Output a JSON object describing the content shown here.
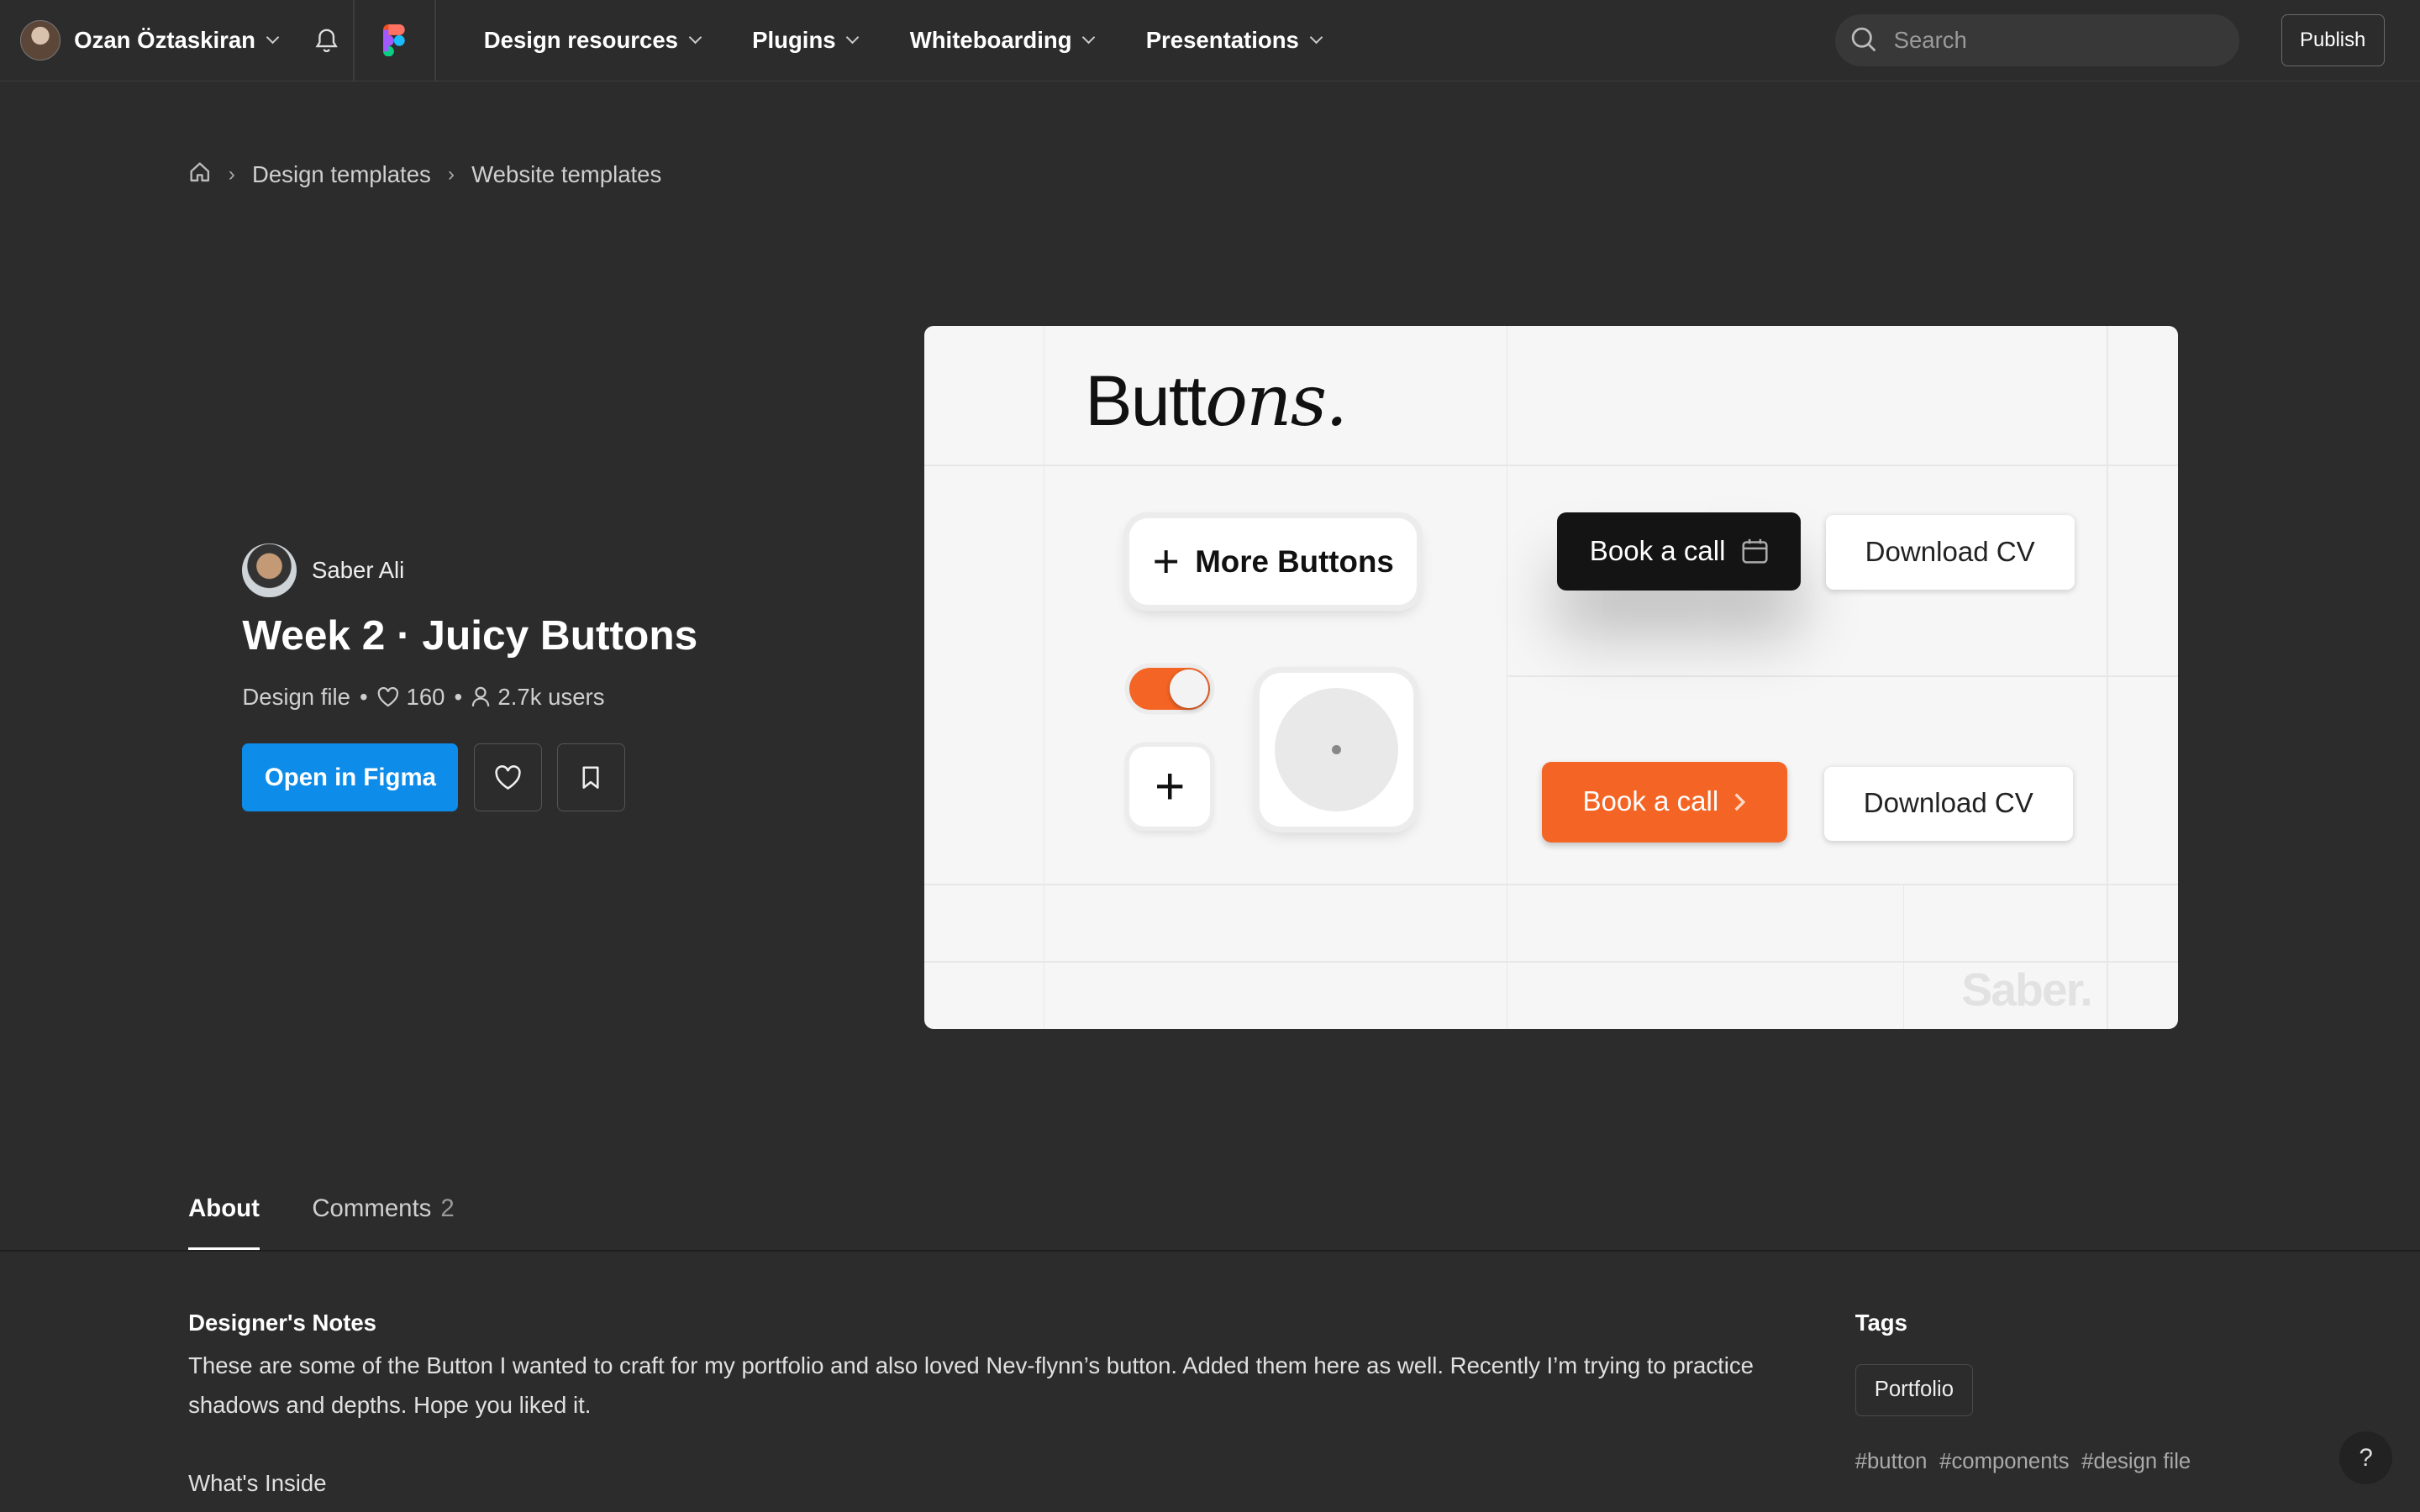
{
  "topbar": {
    "user_name": "Ozan Öztaskiran",
    "nav": [
      "Design resources",
      "Plugins",
      "Whiteboarding",
      "Presentations"
    ],
    "search_placeholder": "Search",
    "publish_label": "Publish"
  },
  "breadcrumb": [
    "Design templates",
    "Website templates"
  ],
  "file": {
    "author": "Saber Ali",
    "title": "Week 2 · Juicy Buttons",
    "type": "Design file",
    "likes": "160",
    "users": "2.7k users",
    "open_label": "Open in Figma"
  },
  "preview": {
    "heading_plain": "Butt",
    "heading_script": "ons.",
    "more_buttons": "More Buttons",
    "book_call": "Book a call",
    "download_cv": "Download CV",
    "watermark": "Saber."
  },
  "tabs": {
    "about": "About",
    "comments": "Comments",
    "comments_count": "2"
  },
  "about": {
    "notes_title": "Designer's Notes",
    "notes_text": "These are some of the Button I wanted to craft for my portfolio and also loved Nev-flynn’s button. Added them here as well. Recently I’m trying to practice shadows and depths. Hope you liked it.",
    "inside_title": "What's Inside"
  },
  "tags": {
    "title": "Tags",
    "chip": "Portfolio",
    "hashtags": [
      "#button",
      "#components",
      "#design file"
    ]
  },
  "help_label": "?",
  "colors": {
    "background": "#2c2c2c",
    "primary": "#0d8ce9",
    "accent_orange": "#f46525"
  }
}
